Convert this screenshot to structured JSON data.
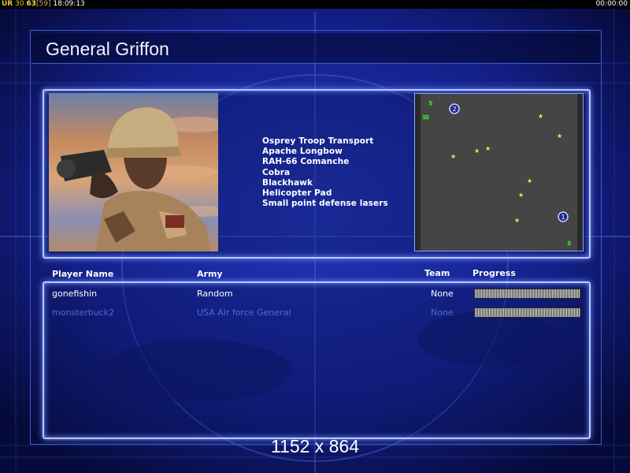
{
  "topbar": {
    "ur_label": "UR",
    "stat_a": "30",
    "stat_b": "63",
    "stat_c": "[59]",
    "clock": "18:09:13",
    "timer": "00:00:00"
  },
  "screen": {
    "title": "General Griffon",
    "resolution": "1152 x 864"
  },
  "briefing": {
    "portrait_icon": "soldier-portrait",
    "units": [
      "Osprey Troop Transport",
      "Apache Longbow",
      "RAH-66 Comanche",
      "Cobra",
      "Blackhawk",
      "Helicopter Pad",
      "Small point defense lasers"
    ]
  },
  "minimap": {
    "start_1": "1",
    "start_2": "2",
    "resource_symbol": "$",
    "star_color": "#ffe066",
    "resource_color": "#35e03a"
  },
  "players_table": {
    "headers": {
      "name": "Player Name",
      "army": "Army",
      "team": "Team",
      "progress": "Progress"
    },
    "rows": [
      {
        "name": "gonefishin",
        "army": "Random",
        "team": "None",
        "progress": 1.0
      },
      {
        "name": "monsterbuck2",
        "army": "USA Air force General",
        "team": "None",
        "progress": 1.0
      }
    ]
  },
  "colors": {
    "background": "#0a0f4a",
    "panel_border": "#b8c8ff",
    "dim_text": "#4e6bcc"
  }
}
